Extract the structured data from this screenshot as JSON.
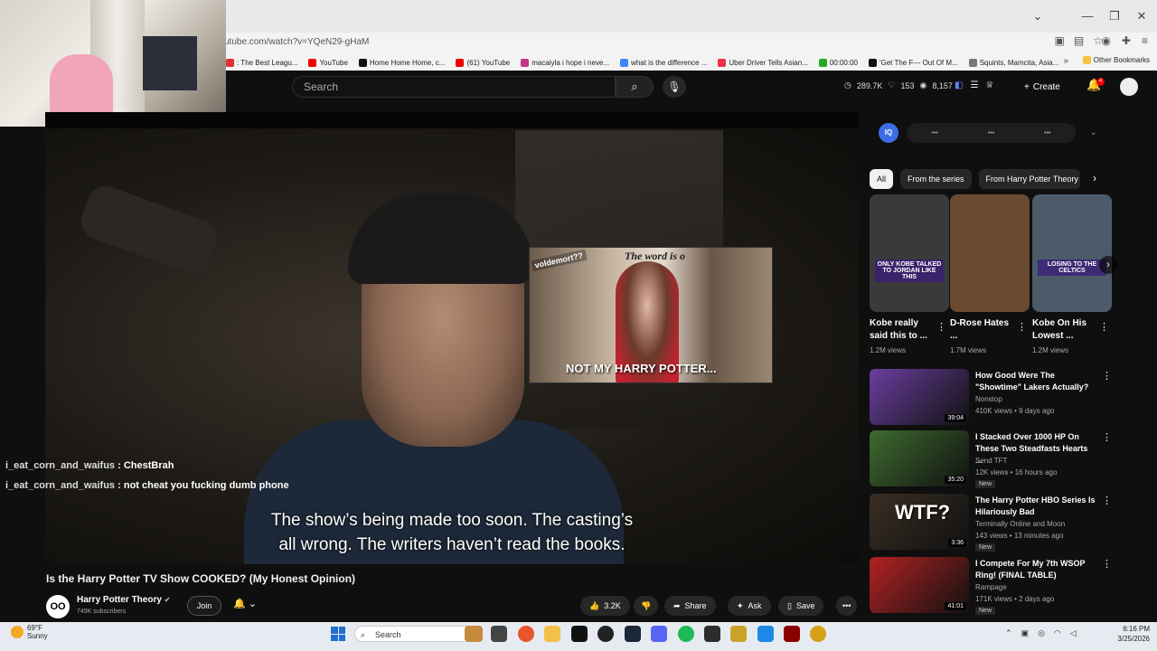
{
  "browser": {
    "url": "utube.com/watch?v=YQeN29-gHaM",
    "window_controls": [
      "⌄",
      "—",
      "❐",
      "✕"
    ],
    "bookmarks": [
      {
        "label": ": The Best Leagu...",
        "color": "#d33"
      },
      {
        "label": "YouTube",
        "color": "#e00"
      },
      {
        "label": "Home Home Home, c...",
        "color": "#111"
      },
      {
        "label": "(61) YouTube",
        "color": "#e00"
      },
      {
        "label": "macaiyla i hope i neve...",
        "color": "#c13584"
      },
      {
        "label": "what is the difference ...",
        "color": "#4285f4"
      },
      {
        "label": "Uber Driver Tells Asian...",
        "color": "#e34"
      },
      {
        "label": "00:00:00",
        "color": "#2a2"
      },
      {
        "label": "'Get The F--- Out Of M...",
        "color": "#111"
      },
      {
        "label": "Squints, Mamcita, Asia...",
        "color": "#777"
      }
    ],
    "other_bookmarks": "Other Bookmarks"
  },
  "header": {
    "search_placeholder": "Search",
    "stats": [
      "289.7K",
      "153",
      "8,157"
    ],
    "create_label": "Create",
    "notification_count": "4"
  },
  "video": {
    "inset": {
      "tag": "voldemort??",
      "words": "The word is o",
      "caption": "NOT MY HARRY POTTER..."
    },
    "chat": [
      {
        "user": "i_eat_corn_and_waifus",
        "message": ": ChestBrah"
      },
      {
        "user": "i_eat_corn_and_waifus",
        "message": ": not cheat you fucking dumb phone"
      }
    ],
    "subtitle": [
      "The show’s being made too soon. The casting’s",
      "all wrong. The writers haven’t read the books."
    ],
    "title": "Is the Harry Potter TV Show COOKED? (My Honest Opinion)",
    "channel": {
      "name": "Harry Potter Theory",
      "subscribers": "749K subscribers",
      "avatar_text": "OO"
    },
    "join_label": "Join",
    "likes": "3.2K",
    "share_label": "Share",
    "ask_label": "Ask",
    "save_label": "Save"
  },
  "sidebar": {
    "iq_logo": "IQ",
    "iq_items": [
      "•••",
      "•••",
      "•••"
    ],
    "chips": [
      "All",
      "From the series",
      "From Harry Potter Theory"
    ],
    "shorts": [
      {
        "title": "Kobe really said this to ...",
        "views": "1.2M views",
        "overlay": "ONLY KOBE TALKED TO JORDAN LIKE THIS",
        "bg": "#3a3a3a"
      },
      {
        "title": "D-Rose Hates ...",
        "views": "1.7M views",
        "overlay": "",
        "bg": "#6a4a30"
      },
      {
        "title": "Kobe On His Lowest ...",
        "views": "1.2M views",
        "overlay": "LOSING TO THE CELTICS",
        "bg": "#4c5b6a"
      }
    ],
    "recommendations": [
      {
        "title": "How Good Were The \"Showtime\" Lakers Actually?",
        "channel": "Nonstop",
        "meta": "410K views • 9 days ago",
        "duration": "39:04",
        "new": "",
        "bg": "#6b3fa0"
      },
      {
        "title": "I Stacked Over 1000 HP On These Two Steadfasts Hearts ...",
        "channel": "Send TFT",
        "meta": "12K views • 16 hours ago",
        "duration": "35:20",
        "new": "New",
        "bg": "#3d6b2f"
      },
      {
        "title": "The Harry Potter HBO Series Is Hilariously Bad",
        "channel": "Terminally Online and Moon",
        "meta": "143 views • 13 minutes ago",
        "duration": "3:36",
        "new": "New",
        "bg": "#3a2e24",
        "overlay": "WTF?"
      },
      {
        "title": "I Compete For My 7th WSOP Ring! (FINAL TABLE)",
        "channel": "Rampage",
        "meta": "171K views • 2 days ago",
        "duration": "41:01",
        "new": "New",
        "bg": "#b32222"
      }
    ]
  },
  "taskbar": {
    "temperature": "69°F",
    "weather": "Sunny",
    "search_label": "Search",
    "time": "6:16 PM",
    "date": "3/25/2026"
  }
}
